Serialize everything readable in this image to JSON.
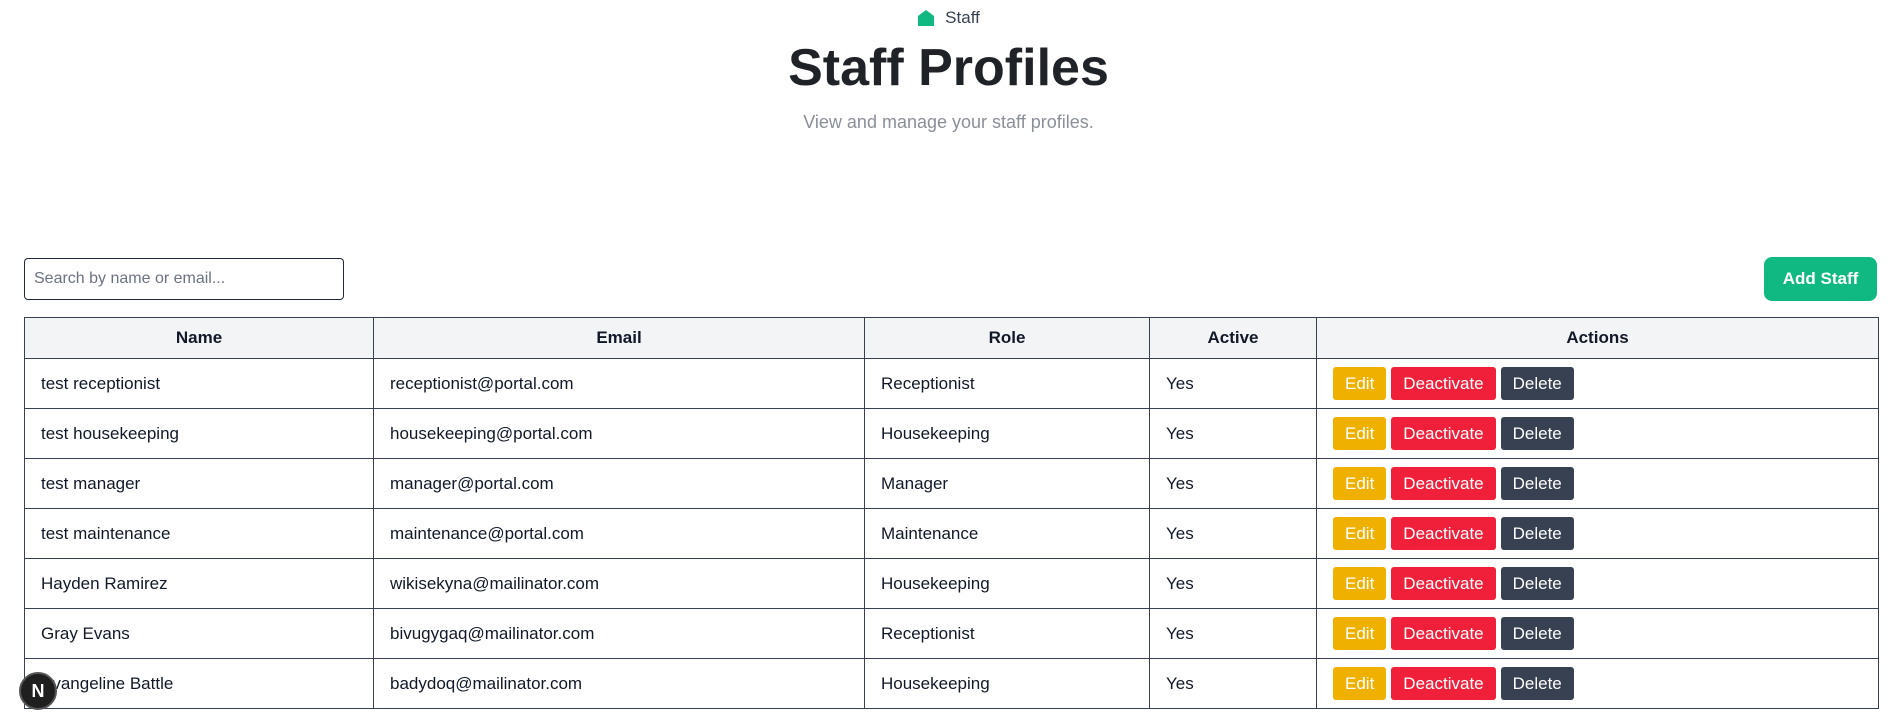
{
  "breadcrumb": {
    "label": "Staff",
    "icon": "home-icon",
    "icon_color": "#10b981"
  },
  "header": {
    "title": "Staff Profiles",
    "subtitle": "View and manage your staff profiles."
  },
  "search": {
    "placeholder": "Search by name or email...",
    "value": ""
  },
  "toolbar": {
    "add_label": "Add Staff"
  },
  "table": {
    "columns": [
      "Name",
      "Email",
      "Role",
      "Active",
      "Actions"
    ],
    "rows": [
      {
        "name": "test receptionist",
        "email": "receptionist@portal.com",
        "role": "Receptionist",
        "active": "Yes"
      },
      {
        "name": "test housekeeping",
        "email": "housekeeping@portal.com",
        "role": "Housekeeping",
        "active": "Yes"
      },
      {
        "name": "test manager",
        "email": "manager@portal.com",
        "role": "Manager",
        "active": "Yes"
      },
      {
        "name": "test maintenance",
        "email": "maintenance@portal.com",
        "role": "Maintenance",
        "active": "Yes"
      },
      {
        "name": "Hayden Ramirez",
        "email": "wikisekyna@mailinator.com",
        "role": "Housekeeping",
        "active": "Yes"
      },
      {
        "name": "Gray Evans",
        "email": "bivugygaq@mailinator.com",
        "role": "Receptionist",
        "active": "Yes"
      },
      {
        "name": "Evangeline Battle",
        "email": "badydoq@mailinator.com",
        "role": "Housekeeping",
        "active": "Yes"
      }
    ],
    "actions": {
      "edit": "Edit",
      "deactivate": "Deactivate",
      "delete": "Delete"
    }
  },
  "dev_badge": {
    "label": "N"
  },
  "colors": {
    "accent": "#10b981",
    "edit": "#f0b000",
    "deactivate": "#f0203a",
    "delete": "#374151"
  }
}
